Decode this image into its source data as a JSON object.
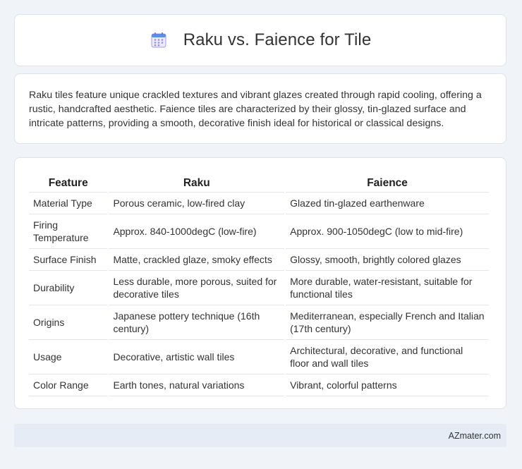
{
  "header": {
    "title": "Raku vs. Faience for Tile",
    "icon": "calendar-icon",
    "icon_color": "#8a7be0"
  },
  "intro": {
    "text": "Raku tiles feature unique crackled textures and vibrant glazes created through rapid cooling, offering a rustic, handcrafted aesthetic. Faience tiles are characterized by their glossy, tin-glazed surface and intricate patterns, providing a smooth, decorative finish ideal for historical or classical designs."
  },
  "table": {
    "headers": [
      "Feature",
      "Raku",
      "Faience"
    ],
    "rows": [
      [
        "Material Type",
        "Porous ceramic, low-fired clay",
        "Glazed tin-glazed earthenware"
      ],
      [
        "Firing Temperature",
        "Approx. 840-1000degC (low-fire)",
        "Approx. 900-1050degC (low to mid-fire)"
      ],
      [
        "Surface Finish",
        "Matte, crackled glaze, smoky effects",
        "Glossy, smooth, brightly colored glazes"
      ],
      [
        "Durability",
        "Less durable, more porous, suited for decorative tiles",
        "More durable, water-resistant, suitable for functional tiles"
      ],
      [
        "Origins",
        "Japanese pottery technique (16th century)",
        "Mediterranean, especially French and Italian (17th century)"
      ],
      [
        "Usage",
        "Decorative, artistic wall tiles",
        "Architectural, decorative, and functional floor and wall tiles"
      ],
      [
        "Color Range",
        "Earth tones, natural variations",
        "Vibrant, colorful patterns"
      ]
    ]
  },
  "footer": {
    "brand": "AZmater.com"
  }
}
